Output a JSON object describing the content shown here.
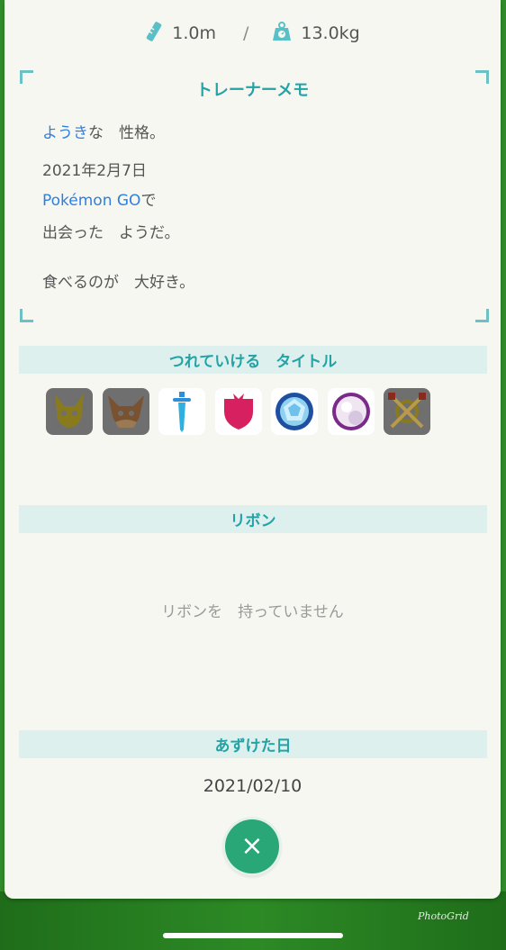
{
  "measurements": {
    "height_icon": "ruler-icon",
    "height": "1.0m",
    "separator": "/",
    "weight_icon": "weight-scale-icon",
    "weight": "13.0kg"
  },
  "memo": {
    "title": "トレーナーメモ",
    "nature_highlight": "ようき",
    "nature_rest": "な　性格。",
    "date": "2021年2月7日",
    "game_highlight": "Pokémon GO",
    "game_rest": "で",
    "met": "出会った　ようだ。",
    "characteristic": "食べるのが　大好き。"
  },
  "titles_section": {
    "label": "つれていける　タイトル",
    "icons": [
      "pikachu-mark-icon",
      "eevee-mark-icon",
      "sword-mark-icon",
      "shield-mark-icon",
      "diamond-mark-icon",
      "pearl-mark-icon",
      "crossed-swords-mark-icon"
    ]
  },
  "ribbons_section": {
    "label": "リボン",
    "empty_text": "リボンを　持っていません"
  },
  "deposit_section": {
    "label": "あずけた日",
    "date": "2021/02/10"
  },
  "close_button": {
    "symbol": "×"
  },
  "watermark": "PhotoGrid",
  "colors": {
    "accent": "#23a3a6",
    "section_bg": "#ddf0ee",
    "link_blue": "#2f7fe0",
    "close_button": "#2aa776"
  }
}
